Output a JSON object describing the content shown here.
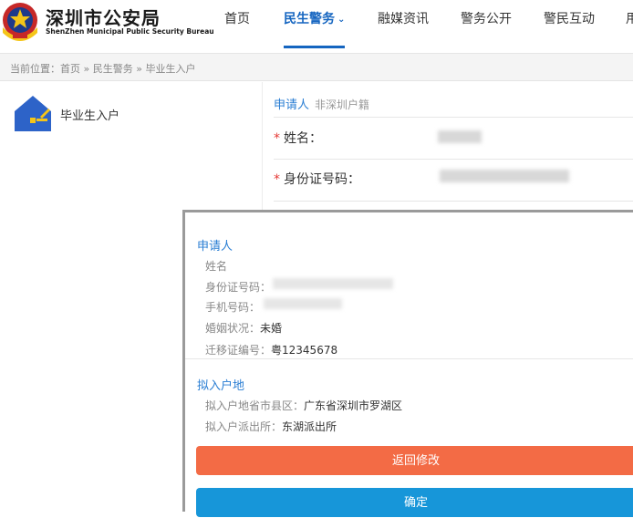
{
  "header": {
    "title": "深圳市公安局",
    "subtitle": "ShenZhen Municipal Public Security Bureau",
    "nav": [
      {
        "label": "首页",
        "active": false
      },
      {
        "label": "民生警务",
        "active": true
      },
      {
        "label": "融媒资讯",
        "active": false
      },
      {
        "label": "警务公开",
        "active": false
      },
      {
        "label": "警民互动",
        "active": false
      },
      {
        "label": "用",
        "active": false
      }
    ],
    "nav_chevron": "⌄"
  },
  "breadcrumb": "当前位置：首页 » 民生警务 » 毕业生入户",
  "sidebar": {
    "items": [
      {
        "label": "毕业生入户",
        "icon": "house-icon"
      }
    ]
  },
  "form": {
    "section_title": "申请人",
    "section_sub": "非深圳户籍",
    "required_mark": "*",
    "name_label": "姓名：",
    "id_label": "身份证号码："
  },
  "modal": {
    "applicant_title": "申请人",
    "rows": [
      {
        "label": "姓名",
        "value": ""
      },
      {
        "label": "身份证号码：",
        "value": ""
      },
      {
        "label": "手机号码：",
        "value": ""
      },
      {
        "label": "婚姻状况：",
        "value": "未婚"
      },
      {
        "label": "迁移证编号：",
        "value": "粤12345678"
      }
    ],
    "household_title": "拟入户地",
    "household_rows": [
      {
        "label": "拟入户地省市县区：",
        "value": "广东省深圳市罗湖区"
      },
      {
        "label": "拟入户派出所：",
        "value": "东湖派出所"
      }
    ],
    "back_button": "返回修改",
    "confirm_button": "确定"
  },
  "colors": {
    "brand_blue": "#1565c0",
    "link_blue": "#2a7ed3",
    "back_orange": "#f36b45",
    "confirm_blue": "#1796d9",
    "required_red": "#e53935"
  }
}
